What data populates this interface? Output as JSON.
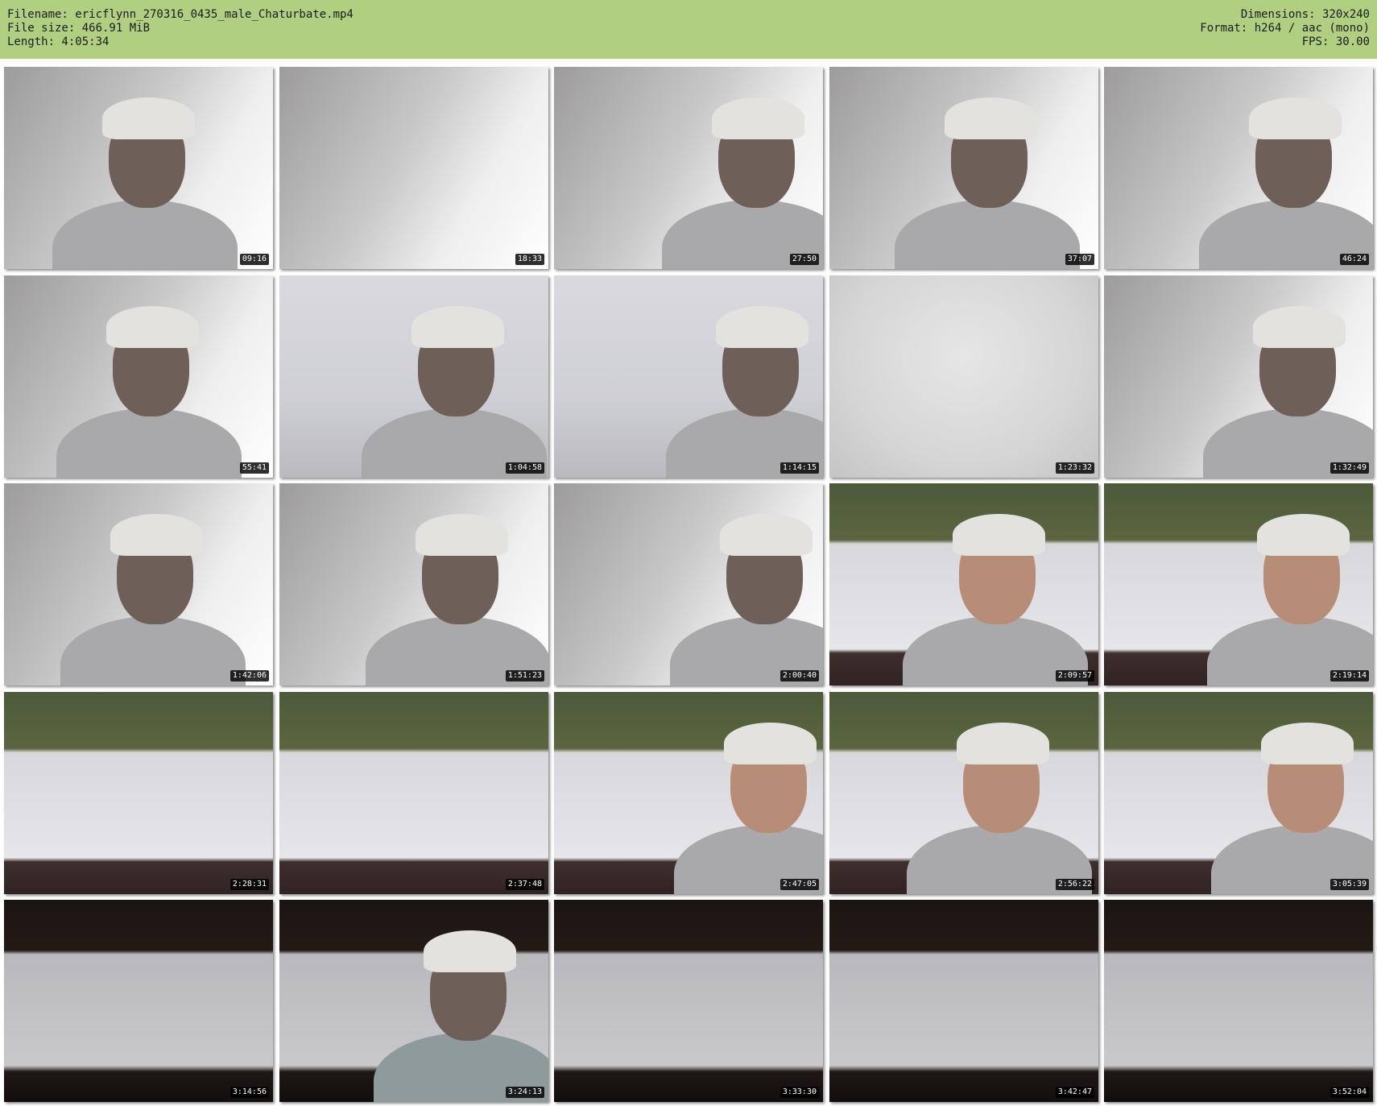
{
  "header": {
    "filename_line": "Filename: ericflynn_270316_0435_male_Chaturbate.mp4",
    "filesize_line": "File size: 466.91 MiB",
    "length_line": "Length: 4:05:34",
    "dimensions_line": "Dimensions: 320x240",
    "format_line": "Format: h264 / aac (mono)",
    "fps_line": "FPS: 30.00"
  },
  "colors": {
    "header_bg": "#b1cf80",
    "page_bg": "#ffffff",
    "timestamp_bg": "#000000"
  },
  "thumbnails": [
    {
      "timestamp": "09:16"
    },
    {
      "timestamp": "18:33"
    },
    {
      "timestamp": "27:50"
    },
    {
      "timestamp": "37:07"
    },
    {
      "timestamp": "46:24"
    },
    {
      "timestamp": "55:41"
    },
    {
      "timestamp": "1:04:58"
    },
    {
      "timestamp": "1:14:15"
    },
    {
      "timestamp": "1:23:32"
    },
    {
      "timestamp": "1:32:49"
    },
    {
      "timestamp": "1:42:06"
    },
    {
      "timestamp": "1:51:23"
    },
    {
      "timestamp": "2:00:40"
    },
    {
      "timestamp": "2:09:57"
    },
    {
      "timestamp": "2:19:14"
    },
    {
      "timestamp": "2:28:31"
    },
    {
      "timestamp": "2:37:48"
    },
    {
      "timestamp": "2:47:05"
    },
    {
      "timestamp": "2:56:22"
    },
    {
      "timestamp": "3:05:39"
    },
    {
      "timestamp": "3:14:56"
    },
    {
      "timestamp": "3:24:13"
    },
    {
      "timestamp": "3:33:30"
    },
    {
      "timestamp": "3:42:47"
    },
    {
      "timestamp": "3:52:04"
    }
  ]
}
